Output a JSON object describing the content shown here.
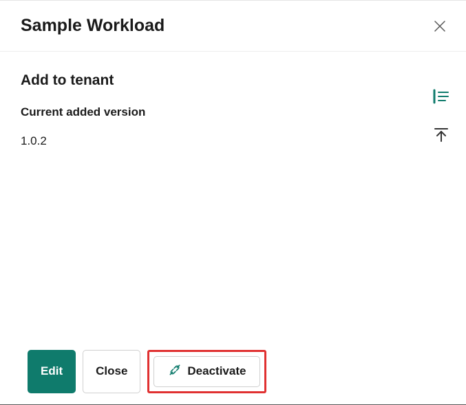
{
  "header": {
    "title": "Sample Workload"
  },
  "section": {
    "title": "Add to tenant",
    "version_label": "Current added version",
    "version_value": "1.0.2"
  },
  "footer": {
    "edit_label": "Edit",
    "close_label": "Close",
    "deactivate_label": "Deactivate"
  }
}
